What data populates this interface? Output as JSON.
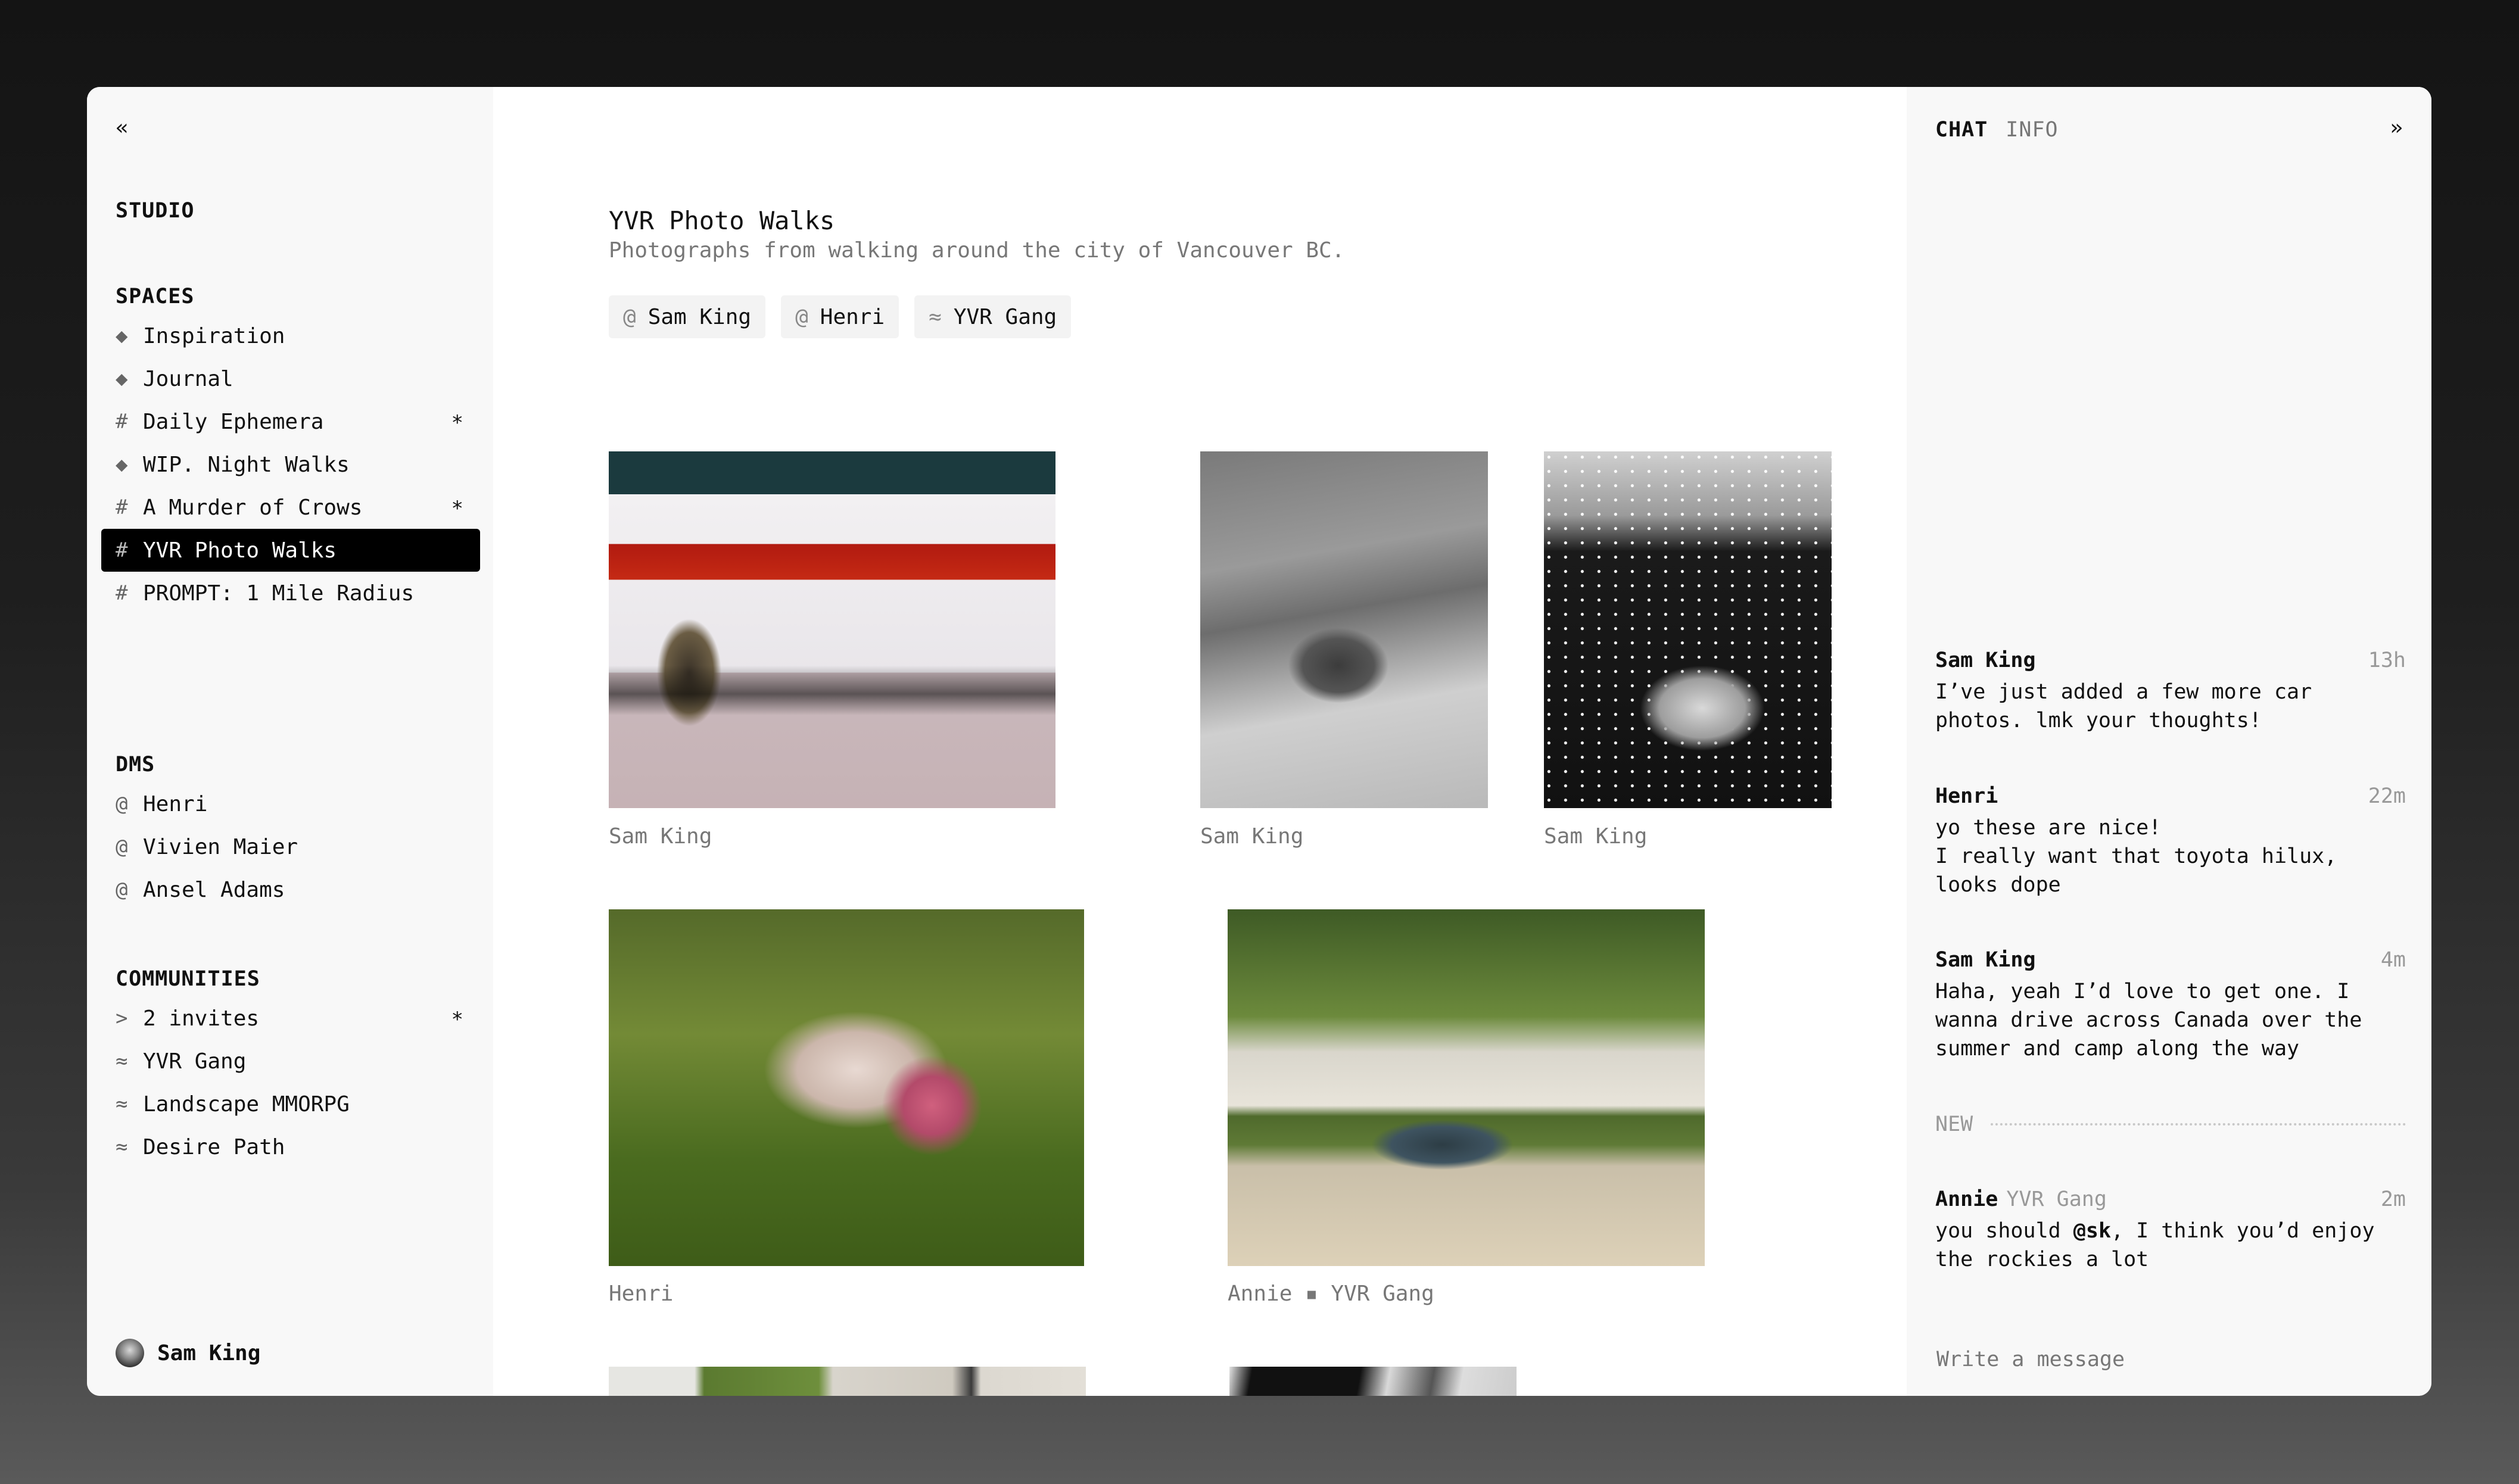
{
  "sidebar": {
    "collapse_glyph": "«",
    "workspace": "STUDIO",
    "spaces_title": "SPACES",
    "spaces": [
      {
        "glyph": "◆",
        "icon": "diamond-icon",
        "label": "Inspiration",
        "starred": false,
        "active": false
      },
      {
        "glyph": "◆",
        "icon": "diamond-icon",
        "label": "Journal",
        "starred": false,
        "active": false
      },
      {
        "glyph": "#",
        "icon": "hash-icon",
        "label": "Daily Ephemera",
        "starred": true,
        "active": false
      },
      {
        "glyph": "◆",
        "icon": "diamond-icon",
        "label": "WIP. Night Walks",
        "starred": false,
        "active": false
      },
      {
        "glyph": "#",
        "icon": "hash-icon",
        "label": "A Murder of Crows",
        "starred": true,
        "active": false
      },
      {
        "glyph": "#",
        "icon": "hash-icon",
        "label": "YVR Photo Walks",
        "starred": false,
        "active": true
      },
      {
        "glyph": "#",
        "icon": "hash-icon",
        "label": "PROMPT: 1 Mile Radius",
        "starred": false,
        "active": false
      }
    ],
    "dms_title": "DMS",
    "dms": [
      {
        "glyph": "@",
        "icon": "at-icon",
        "label": "Henri"
      },
      {
        "glyph": "@",
        "icon": "at-icon",
        "label": "Vivien Maier"
      },
      {
        "glyph": "@",
        "icon": "at-icon",
        "label": "Ansel Adams"
      }
    ],
    "communities_title": "COMMUNITIES",
    "communities": [
      {
        "glyph": ">",
        "icon": "chevron-right-icon",
        "label": "2 invites",
        "starred": true
      },
      {
        "glyph": "≈",
        "icon": "wave-icon",
        "label": "YVR Gang",
        "starred": false
      },
      {
        "glyph": "≈",
        "icon": "wave-icon",
        "label": "Landscape MMORPG",
        "starred": false
      },
      {
        "glyph": "≈",
        "icon": "wave-icon",
        "label": "Desire Path",
        "starred": false
      }
    ],
    "star_glyph": "*",
    "user": {
      "name": "Sam King"
    }
  },
  "main": {
    "title": "YVR Photo Walks",
    "description": "Photographs from walking around the city of Vancouver BC.",
    "members": [
      {
        "glyph": "@",
        "label": "Sam King"
      },
      {
        "glyph": "@",
        "label": "Henri"
      },
      {
        "glyph": "≈",
        "label": "YVR Gang"
      }
    ],
    "photos": [
      {
        "subject": "white Honda Civic rear",
        "caption": "Sam King"
      },
      {
        "subject": "black and white Toyota Hilux truck",
        "caption": "Sam King"
      },
      {
        "subject": "car headlight with petals",
        "caption": "Sam King"
      },
      {
        "subject": "house with flowering garden",
        "caption": "Henri"
      },
      {
        "subject": "blue pickup truck on street",
        "caption": "Annie ▪ YVR Gang"
      },
      {
        "subject": "garden and lattice fence",
        "caption": ""
      },
      {
        "subject": "black and white tree branches",
        "caption": ""
      }
    ]
  },
  "chat": {
    "tabs": [
      {
        "label": "CHAT",
        "active": true
      },
      {
        "label": "INFO",
        "active": false
      }
    ],
    "collapse_glyph": "»",
    "messages": [
      {
        "author": "Sam King",
        "group": "",
        "time": "13h",
        "body": "I’ve just added a few more car photos. lmk your thoughts!"
      },
      {
        "author": "Henri",
        "group": "",
        "time": "22m",
        "body": "yo these are nice!\nI really want that toyota hilux, looks dope"
      },
      {
        "author": "Sam King",
        "group": "",
        "time": "4m",
        "body": "Haha, yeah I’d love to get one. I wanna drive across Canada over the summer and camp along the way"
      },
      {
        "author": "Annie",
        "group": "YVR Gang",
        "time": "2m",
        "body_before": "you should ",
        "mention": "@sk",
        "body_after": ", I think you’d enjoy the rockies a lot"
      }
    ],
    "new_label": "NEW",
    "composer_placeholder": "Write a message"
  }
}
